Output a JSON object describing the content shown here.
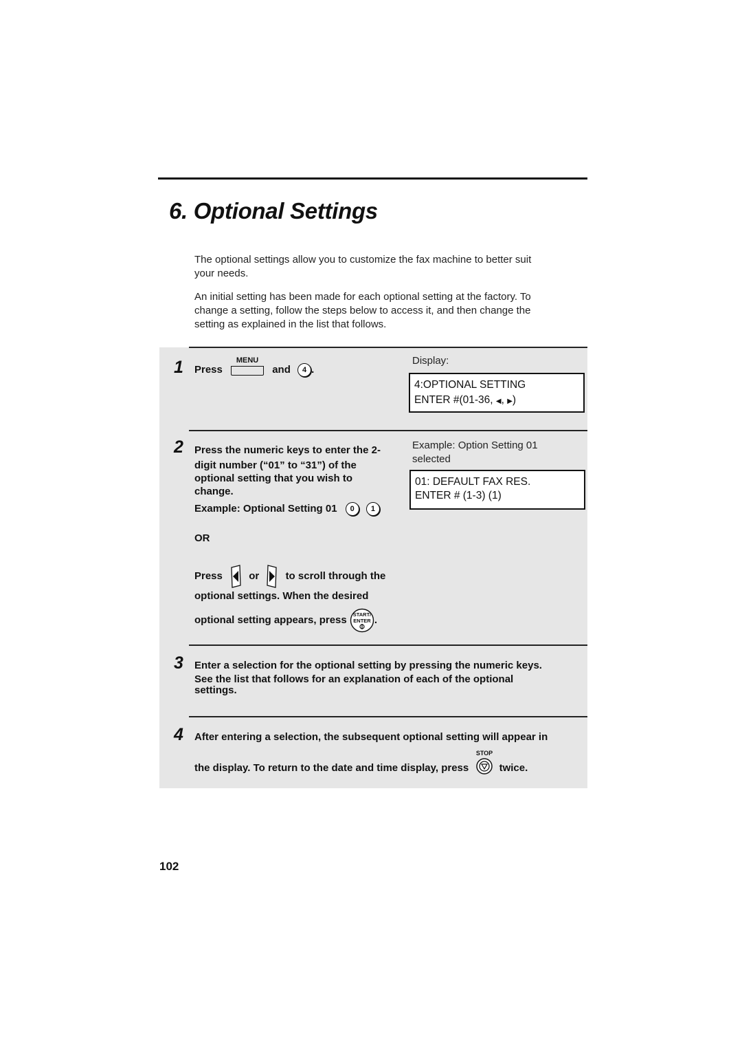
{
  "page": {
    "section_title": "6.  Optional Settings",
    "page_number": "102"
  },
  "intro": {
    "para1_line1": "The optional settings allow you to customize the fax machine to better suit",
    "para1_line2": "your needs.",
    "para2_line1": "An initial setting has been made for each optional setting at the factory. To",
    "para2_line2": "change a setting, follow the steps below to access it, and then change the",
    "para2_line3": "setting as explained in the list that follows."
  },
  "steps": [
    {
      "number": "1",
      "press_label": "Press",
      "menu_key_label": "MENU",
      "and_label": "and",
      "key_4": "4",
      "end_punct": ".",
      "display_caption": "Display:",
      "display_line1": "4:OPTIONAL SETTING",
      "display_line2_prefix": "ENTER #(01-36, ",
      "display_line2_left_arrow": "◀",
      "display_line2_sep": ", ",
      "display_line2_right_arrow": "▶",
      "display_line2_suffix": ")"
    },
    {
      "number": "2",
      "line1": "Press the numeric keys to enter the 2-",
      "line2": "digit number (“01” to “31”) of the",
      "line3": "optional setting that you wish to",
      "line4": "change.",
      "example_label": "Example: Optional Setting 01",
      "example_key1": "0",
      "example_key2": "1",
      "or_label": "OR",
      "scroll_press": "Press",
      "scroll_or": "or",
      "scroll_rest": "to scroll through the",
      "scroll_line2": "optional settings. When the desired",
      "scroll_line3": "optional setting appears, press",
      "start_key_top": "START/",
      "start_key_bottom": "ENTER",
      "end_punct": ".",
      "display_caption_line1": "Example: Option Setting 01",
      "display_caption_line2": "selected",
      "display_line1": "01: DEFAULT FAX RES.",
      "display_line2": "ENTER # (1-3) (1)"
    },
    {
      "number": "3",
      "line1": "Enter a selection for the optional setting by pressing the numeric keys.",
      "line2": "See the list that follows for an explanation of each of the optional",
      "line3": "settings."
    },
    {
      "number": "4",
      "line1": "After entering a selection, the subsequent optional setting will appear in",
      "line2": "the display. To return to the date and time display, press",
      "stop_key_label": "STOP",
      "line2_end": "twice."
    }
  ]
}
